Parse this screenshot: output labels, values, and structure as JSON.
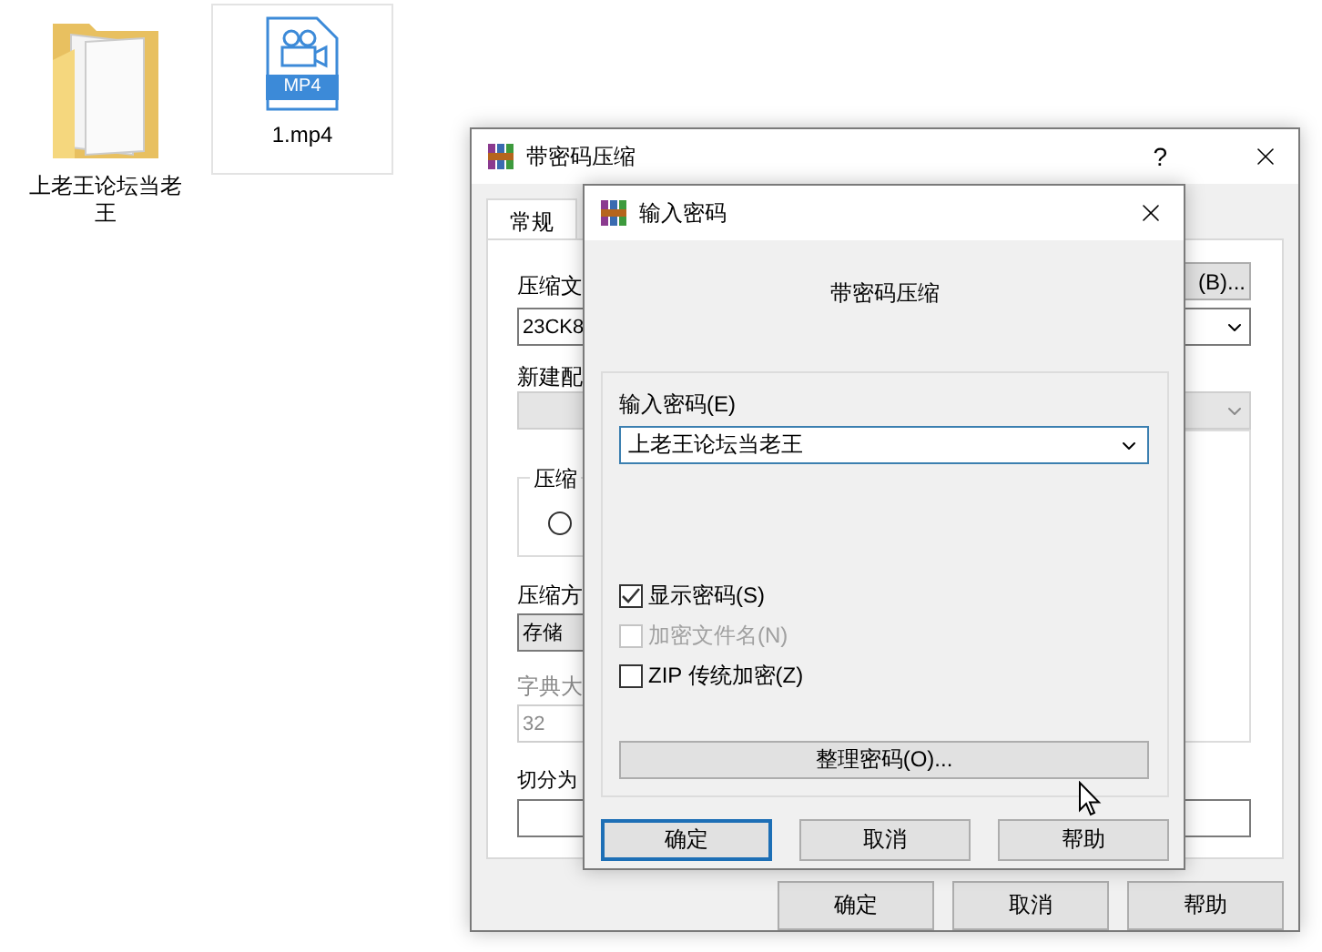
{
  "desktop_icons": [
    {
      "kind": "folder",
      "label": "上老王论坛当老王",
      "selected": false
    },
    {
      "kind": "video",
      "label": "1.mp4",
      "badge": "MP4",
      "selected": true
    }
  ],
  "back_window": {
    "title": "带密码压缩",
    "help": "?",
    "tabs": [
      {
        "label": "常规",
        "selected": true
      }
    ],
    "archive_label": "压缩文",
    "browse_button": "(B)...",
    "archive_value": "23CK8",
    "profile_label": "新建配",
    "format_group": "压缩",
    "format_radio": {
      "selected": false
    },
    "method_label": "压缩方",
    "method_value": "存储",
    "dict_label": "字典大",
    "dict_value": "32",
    "split_label": "切分为",
    "buttons": [
      {
        "label": "确定"
      },
      {
        "label": "取消"
      },
      {
        "label": "帮助"
      }
    ]
  },
  "front_window": {
    "title": "输入密码",
    "heading": "带密码压缩",
    "password_label": "输入密码(E)",
    "password_value": "上老王论坛当老王",
    "options": [
      {
        "label": "显示密码(S)",
        "checked": true,
        "disabled": false
      },
      {
        "label": "加密文件名(N)",
        "checked": false,
        "disabled": true
      },
      {
        "label": "ZIP 传统加密(Z)",
        "checked": false,
        "disabled": false
      }
    ],
    "manage_button": "整理密码(O)...",
    "buttons": [
      {
        "label": "确定",
        "default": true
      },
      {
        "label": "取消",
        "default": false
      },
      {
        "label": "帮助",
        "default": false
      }
    ]
  }
}
